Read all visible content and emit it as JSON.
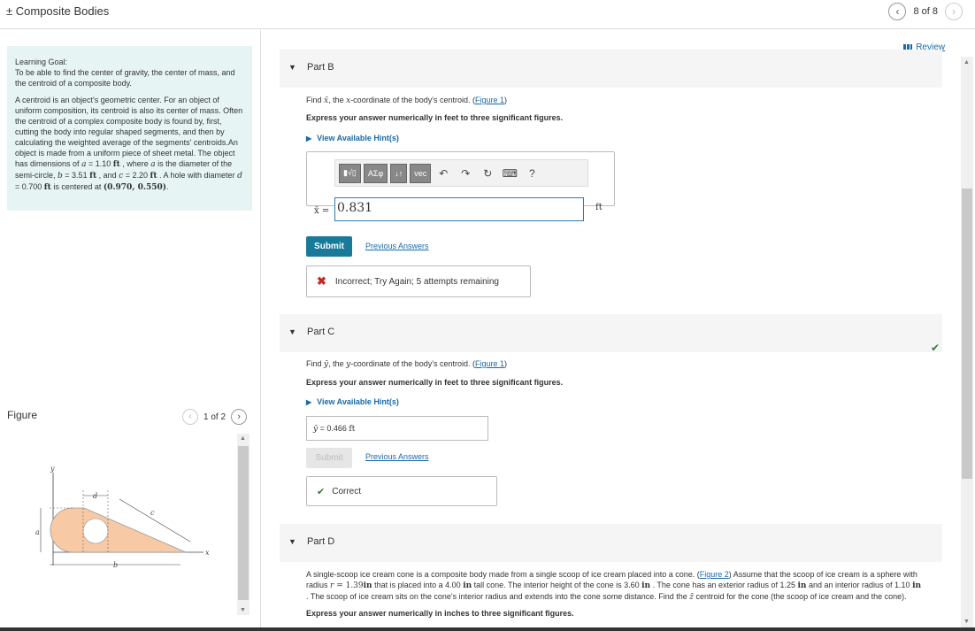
{
  "header": {
    "title": "± Composite Bodies",
    "page_indicator": "8 of 8",
    "prev_glyph": "‹",
    "next_glyph": "›"
  },
  "left": {
    "goal_heading": "Learning Goal:",
    "goal_text": "To be able to find the center of gravity, the center of mass, and the centroid of a composite body.",
    "para_1": "A centroid is an object's geometric center. For an object of uniform composition, its centroid is also its center of mass. Often the centroid of a complex composite body is found by, first, cutting the body into regular shaped segments, and then by calculating the weighted average of the segments' centroids.An object is made from a uniform piece of sheet metal. The object has dimensions of",
    "a_sym": "a",
    "a_val": " = 1.10 ",
    "ft": "ft",
    "where_a": " , where ",
    "a_desc": " is the diameter of the semi-circle,",
    "b_sym": "b",
    "b_val": " = 3.51 ",
    "and_c": " , and ",
    "c_sym": "c",
    "c_val": " = 2.20 ",
    "hole_text": " . A hole with diameter ",
    "d_sym": "d",
    "d_val": " = 0.700 ",
    "centered": " is centered at",
    "center_coord": "(0.970, 0.550)",
    "period": ".",
    "figure_label": "Figure",
    "figure_pager": "1 of 2",
    "figure_labels": {
      "y": "y",
      "x": "x",
      "a": "a",
      "b": "b",
      "c": "c",
      "d": "d"
    }
  },
  "main": {
    "review": "Review",
    "part_b": {
      "label": "Part B",
      "find_1": "Find ",
      "sym": "x̄",
      "find_2": ", the ",
      "coord_sym": "x",
      "find_3": "-coordinate of the body's centroid. (",
      "figure_link": "Figure 1",
      "find_4": ")",
      "express": "Express your answer numerically in feet to three significant figures.",
      "hint": "View Available Hint(s)",
      "toolbar": [
        "▮√▯",
        "ΑΣφ",
        "↓↑",
        "vec"
      ],
      "toolbar_icons": [
        "undo-icon",
        "redo-icon",
        "reset-icon",
        "keyboard-icon",
        "help-icon"
      ],
      "help_glyph": "?",
      "eq_label": "x̄ =",
      "answer": "0.831",
      "unit": "ft",
      "submit": "Submit",
      "previous": "Previous Answers",
      "feedback_icon": "✖",
      "feedback": "Incorrect; Try Again; 5 attempts remaining"
    },
    "part_c": {
      "label": "Part C",
      "find_1": "Find ",
      "sym": "ȳ",
      "find_2": ", the ",
      "coord_sym": "y",
      "find_3": "-coordinate of the body's centroid. (",
      "figure_link": "Figure 1",
      "find_4": ")",
      "express": "Express your answer numerically in feet to three significant figures.",
      "hint": "View Available Hint(s)",
      "answer_sym": "ȳ",
      "answer_eq": " = 0.466 ",
      "answer_unit": "ft",
      "submit": "Submit",
      "previous": "Previous Answers",
      "feedback_icon": "✔",
      "feedback": "Correct"
    },
    "part_d": {
      "label": "Part D",
      "t1": "A single-scoop ice cream cone is a composite body made from a single scoop of ice cream placed into a cone. (",
      "figure_link": "Figure 2",
      "t2": ") Assume that the scoop of ice cream is a sphere with radius ",
      "r_sym": "r",
      "r_val": " = 1.39",
      "in": "in",
      "t3": " that is placed into a 4.00 ",
      "t4": " tall cone. The interior height of the cone is 3.60 ",
      "t5": " . The cone has an exterior radius of 1.25 ",
      "t6": " and an interior radius of 1.10 ",
      "t7": " . The scoop of ice cream sits on the cone's interior radius and extends into the cone some distance. Find the ",
      "zbar": "z̄",
      "t8": " centroid for the cone (the scoop of ice cream and the cone).",
      "express": "Express your answer numerically in inches to three significant figures."
    }
  }
}
